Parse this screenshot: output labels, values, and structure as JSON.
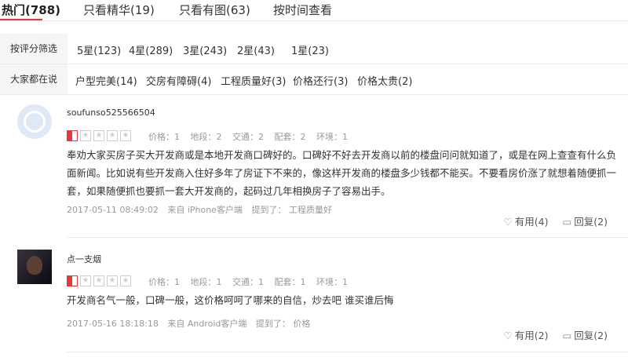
{
  "tabs": [
    {
      "label": "热门(788)",
      "active": true
    },
    {
      "label": "只看精华(19)",
      "active": false
    },
    {
      "label": "只看有图(63)",
      "active": false
    },
    {
      "label": "按时间查看",
      "active": false
    }
  ],
  "rating_filter": {
    "label": "按评分筛选",
    "options": [
      "5星(123)",
      "4星(289)",
      "3星(243)",
      "2星(43)",
      "1星(23)"
    ]
  },
  "tag_filter": {
    "label": "大家都在说",
    "options": [
      "户型完美(14)",
      "交房有障碍(4)",
      "工程质量好(3)",
      "价格还行(3)",
      "价格太贵(2)"
    ]
  },
  "reviews": [
    {
      "username": "soufunso525566504",
      "rating": 1.5,
      "scores": [
        "价格：1",
        "地段：2",
        "交通：2",
        "配套：2",
        "环境：1"
      ],
      "content": "奉劝大家买房子买大开发商或是本地开发商口碑好的。口碑好不好去开发商以前的楼盘问问就知道了，或是在网上查查有什么负面新闻。比如说有些开发商入住好多年了房证下不来的，像这样开发商的楼盘多少钱都不能买。不要看房价涨了就想着随便抓一套，如果随便抓也要抓一套大开发商的，起码过几年相换房子了容易出手。",
      "timestamp": "2017-05-11 08:49:02",
      "source": "来自 iPhone客户端",
      "mention_label": "提到了：",
      "mention": "工程质量好",
      "useful": "有用(4)",
      "reply": "回复(2)"
    },
    {
      "username": "点一支烟",
      "rating": 1.5,
      "scores": [
        "价格：1",
        "地段：1",
        "交通：1",
        "配套：1",
        "环境：1"
      ],
      "content": "开发商名气一般，口碑一般，这价格呵呵了哪来的自信，炒去吧 谁买谁后悔",
      "timestamp": "2017-05-16 18:18:18",
      "source": "来自 Android客户端",
      "mention_label": "提到了：",
      "mention": "价格",
      "useful": "有用(2)",
      "reply": "回复(2)"
    }
  ],
  "icons": {
    "heart": "heart-icon",
    "reply": "reply-icon"
  },
  "colors": {
    "accent": "#e4393c",
    "muted": "#999999"
  }
}
